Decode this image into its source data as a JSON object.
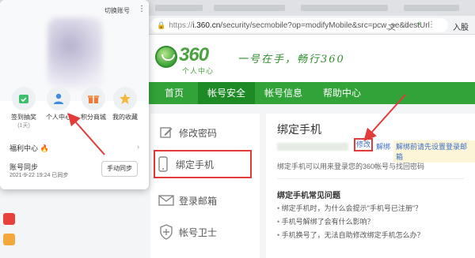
{
  "browser": {
    "url_scheme": "https://",
    "url_host": "i.360.cn",
    "url_path": "/security/secmobile?op=modifyMobile&src=pcw_se&destUrl",
    "user_label": "入股"
  },
  "site": {
    "logo_number": "360",
    "logo_sub": "个人中心",
    "slogan": "一号在手，畅行360",
    "brand_green": "#32a339",
    "nav": [
      "首页",
      "帐号安全",
      "帐号信息",
      "帮助中心"
    ],
    "nav_active_index": 1
  },
  "sidebar": {
    "items": [
      {
        "label": "修改密码",
        "icon": "pencil-edit-icon"
      },
      {
        "label": "绑定手机",
        "icon": "mobile-phone-icon"
      },
      {
        "label": "登录邮箱",
        "icon": "envelope-icon"
      },
      {
        "label": "帐号卫士",
        "icon": "shield-plus-icon"
      }
    ],
    "active_index": 1
  },
  "panel": {
    "title": "绑定手机",
    "modify_label": "修改",
    "unbind_label": "解绑",
    "unbind_tip": "解绑前请先设置登录邮箱",
    "description": "绑定手机可以用来登录您的360帐号与找回密码",
    "faq_title": "绑定手机常见问题",
    "faq": [
      "绑定手机时，为什么会提示\"手机号已注册\"？",
      "手机号解绑了会有什么影响？",
      "手机换号了，无法自助修改绑定手机怎么办？"
    ]
  },
  "popup": {
    "switch_account": "切换账号",
    "shortcuts": [
      {
        "label": "签到抽奖",
        "sub": "(1天)",
        "icon": "sign-in-calendar-icon"
      },
      {
        "label": "个人中心",
        "sub": "",
        "icon": "user-center-icon"
      },
      {
        "label": "积分商城",
        "sub": "",
        "icon": "gift-box-icon"
      },
      {
        "label": "我的收藏",
        "sub": "",
        "icon": "star-icon"
      }
    ],
    "welfare": "福利中心",
    "sync_title": "账号同步",
    "sync_time": "2021-9-22 19:24 已同步",
    "sync_button": "手动同步"
  },
  "colors": {
    "highlight_red": "#e33a3a",
    "link_blue": "#3b6fc9"
  }
}
